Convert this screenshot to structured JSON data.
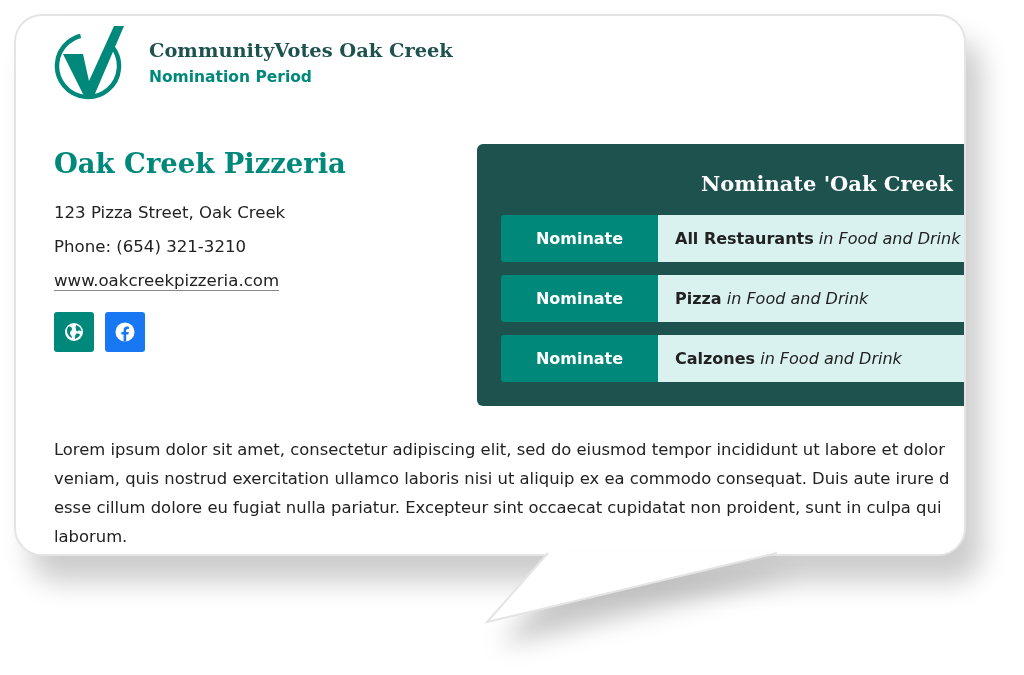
{
  "header": {
    "title": "CommunityVotes Oak Creek",
    "subtitle": "Nomination Period"
  },
  "business": {
    "name": "Oak Creek Pizzeria",
    "address": "123 Pizza Street, Oak Creek",
    "phone": "Phone: (654) 321-3210",
    "website": "www.oakcreekpizzeria.com",
    "social_links": [
      {
        "kind": "website"
      },
      {
        "kind": "facebook"
      }
    ]
  },
  "nominate_panel": {
    "title": "Nominate 'Oak Creek",
    "rows": [
      {
        "button": "Nominate",
        "category": "**All Restaurants** *in Food and Drink*"
      },
      {
        "button": "Nominate",
        "category": "**Pizza** *in Food and Drink*"
      },
      {
        "button": "Nominate",
        "category": "**Calzones** *in Food and Drink*"
      }
    ]
  },
  "description": {
    "lines": [
      "Lorem ipsum dolor sit amet, consectetur adipiscing elit, sed do eiusmod tempor incididunt ut labore et dolor",
      "veniam, quis nostrud exercitation ullamco laboris nisi ut aliquip ex ea commodo consequat. Duis aute irure d",
      "esse cillum dolore eu fugiat nulla pariatur. Excepteur sint occaecat cupidatat non proident, sunt in culpa qui",
      "laborum."
    ]
  }
}
